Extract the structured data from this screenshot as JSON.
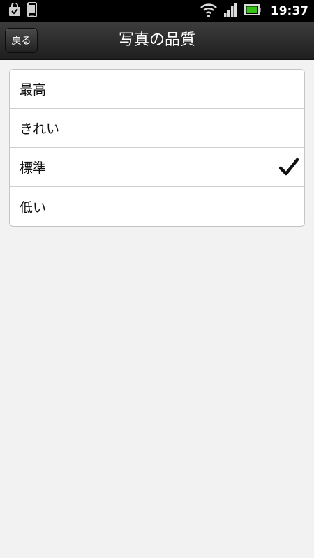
{
  "status_bar": {
    "time": "19:37",
    "icons": [
      "shopping-bag-icon",
      "phone-icon",
      "wifi-icon",
      "signal-icon",
      "battery-icon"
    ],
    "battery_color": "#39c11a"
  },
  "header": {
    "back_label": "戻る",
    "title": "写真の品質"
  },
  "options": [
    {
      "label": "最高",
      "selected": false
    },
    {
      "label": "きれい",
      "selected": false
    },
    {
      "label": "標準",
      "selected": true
    },
    {
      "label": "低い",
      "selected": false
    }
  ]
}
